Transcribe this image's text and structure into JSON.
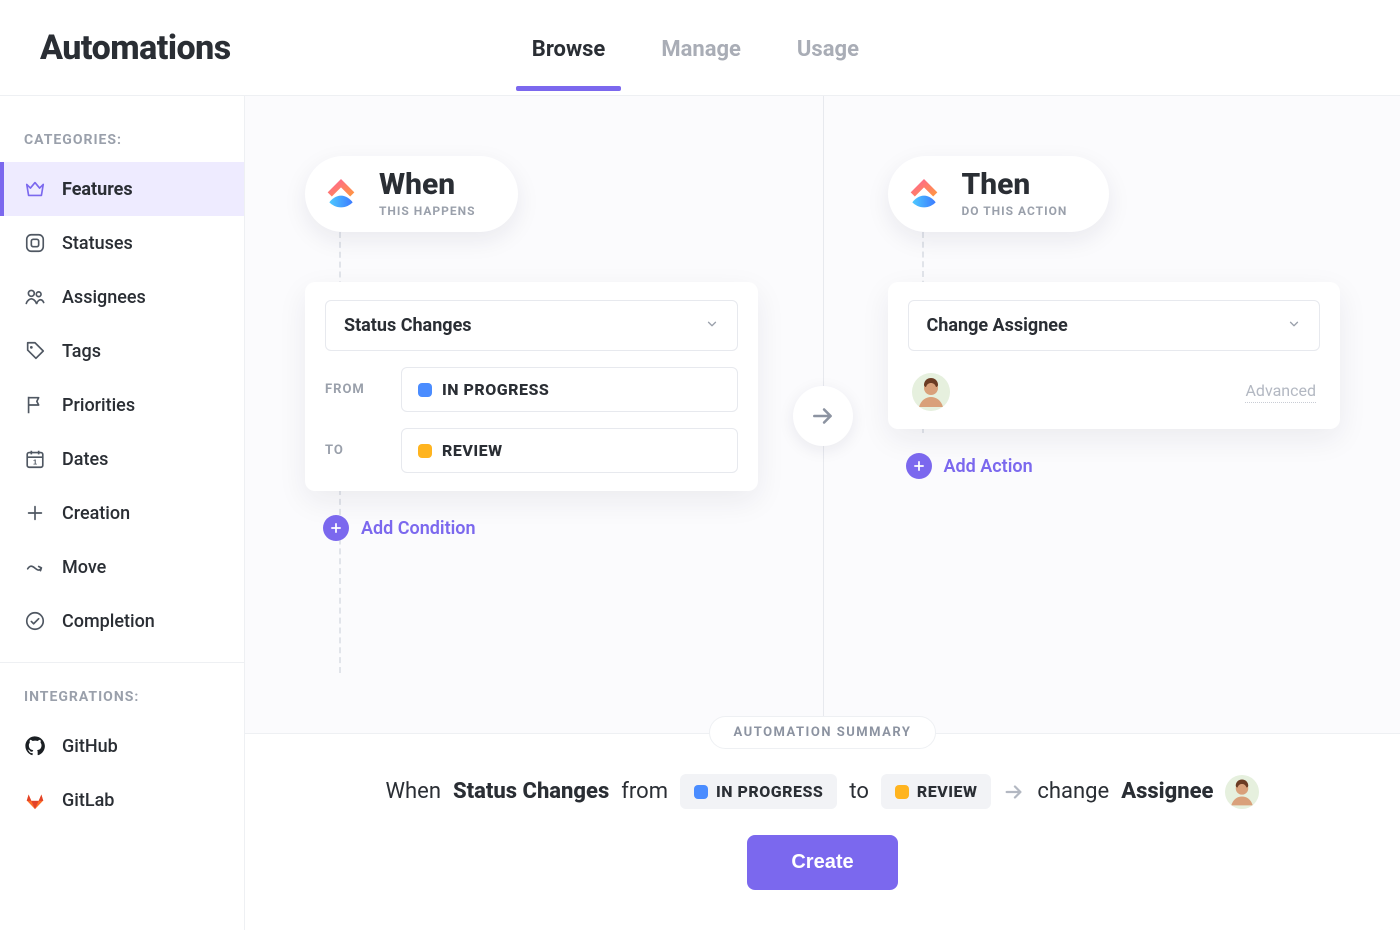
{
  "header": {
    "title": "Automations",
    "tabs": [
      {
        "label": "Browse",
        "active": true
      },
      {
        "label": "Manage",
        "active": false
      },
      {
        "label": "Usage",
        "active": false
      }
    ]
  },
  "sidebar": {
    "categories_heading": "CATEGORIES:",
    "integrations_heading": "INTEGRATIONS:",
    "categories": [
      {
        "label": "Features",
        "icon": "crown-icon",
        "active": true
      },
      {
        "label": "Statuses",
        "icon": "status-icon",
        "active": false
      },
      {
        "label": "Assignees",
        "icon": "people-icon",
        "active": false
      },
      {
        "label": "Tags",
        "icon": "tag-icon",
        "active": false
      },
      {
        "label": "Priorities",
        "icon": "flag-icon",
        "active": false
      },
      {
        "label": "Dates",
        "icon": "calendar-icon",
        "active": false
      },
      {
        "label": "Creation",
        "icon": "plus-outline-icon",
        "active": false
      },
      {
        "label": "Move",
        "icon": "move-icon",
        "active": false
      },
      {
        "label": "Completion",
        "icon": "check-circle-icon",
        "active": false
      }
    ],
    "integrations": [
      {
        "label": "GitHub",
        "icon": "github-icon"
      },
      {
        "label": "GitLab",
        "icon": "gitlab-icon"
      }
    ]
  },
  "builder": {
    "when": {
      "title": "When",
      "subtitle": "THIS HAPPENS",
      "trigger": "Status Changes",
      "from_label": "FROM",
      "to_label": "TO",
      "from_status": {
        "name": "IN PROGRESS",
        "color": "blue"
      },
      "to_status": {
        "name": "REVIEW",
        "color": "amber"
      },
      "add_condition": "Add Condition"
    },
    "then": {
      "title": "Then",
      "subtitle": "DO THIS ACTION",
      "action": "Change Assignee",
      "advanced_label": "Advanced",
      "add_action": "Add Action"
    }
  },
  "summary": {
    "label": "AUTOMATION SUMMARY",
    "when_word": "When",
    "trigger": "Status Changes",
    "from_word": "from",
    "from_status": "IN PROGRESS",
    "to_word": "to",
    "to_status": "REVIEW",
    "change_word": "change",
    "object": "Assignee",
    "create_button": "Create"
  },
  "colors": {
    "accent": "#7b68ee",
    "blue": "#4a8cff",
    "amber": "#ffb41f"
  }
}
